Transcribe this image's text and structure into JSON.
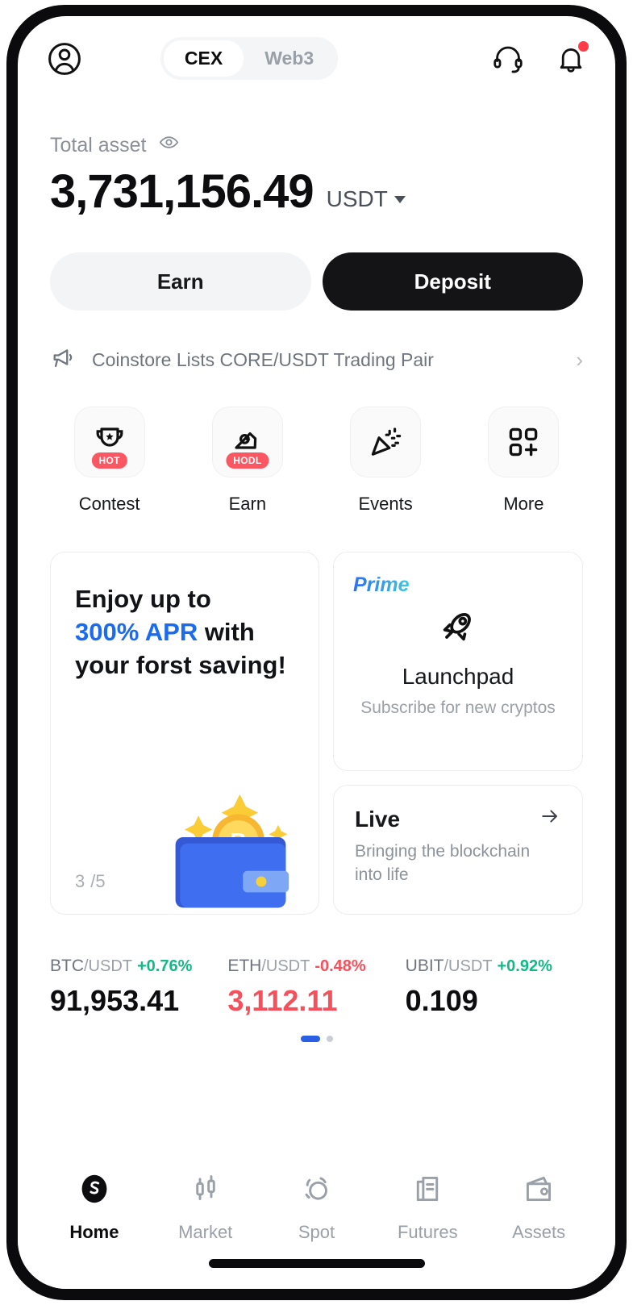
{
  "header": {
    "avatar_icon": "user-circle-icon",
    "segments": [
      {
        "label": "CEX",
        "active": true
      },
      {
        "label": "Web3",
        "active": false
      }
    ],
    "support_icon": "headset-icon",
    "notification_icon": "bell-icon",
    "has_notification": true
  },
  "balance": {
    "label": "Total asset",
    "eye_icon": "eye-icon",
    "amount": "3,731,156.49",
    "currency": "USDT"
  },
  "actions": {
    "earn_label": "Earn",
    "deposit_label": "Deposit"
  },
  "announcement": {
    "icon": "megaphone-icon",
    "text": "Coinstore Lists CORE/USDT Trading Pair",
    "chevron": "›"
  },
  "quick_actions": [
    {
      "label": "Contest",
      "icon": "trophy-icon",
      "badge": "HOT"
    },
    {
      "label": "Earn",
      "icon": "piggy-hand-icon",
      "badge": "HODL"
    },
    {
      "label": "Events",
      "icon": "party-popper-icon",
      "badge": ""
    },
    {
      "label": "More",
      "icon": "grid-plus-icon",
      "badge": ""
    }
  ],
  "promo_card": {
    "line1": "Enjoy up to",
    "highlight": "300% APR",
    "line2_rest": " with",
    "line3": "your forst saving!",
    "counter_current": "3",
    "counter_total": "/5",
    "art": "wallet-bitcoin-illustration",
    "highlight_color": "#1a6bf0"
  },
  "launchpad_card": {
    "badge": "Prime",
    "icon": "rocket-icon",
    "title": "Launchpad",
    "subtitle": "Subscribe for new cryptos"
  },
  "live_card": {
    "title": "Live",
    "arrow_icon": "arrow-right-icon",
    "subtitle": "Bringing the blockchain into life"
  },
  "tickers": [
    {
      "symbol": "BTC",
      "quote": "/USDT",
      "change": "+0.76%",
      "price": "91,953.41",
      "direction": "up"
    },
    {
      "symbol": "ETH",
      "quote": "/USDT",
      "change": "-0.48%",
      "price": "3,112.11",
      "direction": "down"
    },
    {
      "symbol": "UBIT",
      "quote": "/USDT",
      "change": "+0.92%",
      "price": "0.109",
      "direction": "up"
    }
  ],
  "carousel": {
    "active_index": 0,
    "count": 2
  },
  "nav": [
    {
      "label": "Home",
      "icon": "coinstore-logo-icon",
      "active": true
    },
    {
      "label": "Market",
      "icon": "candlestick-icon",
      "active": false
    },
    {
      "label": "Spot",
      "icon": "swap-circles-icon",
      "active": false
    },
    {
      "label": "Futures",
      "icon": "document-chart-icon",
      "active": false
    },
    {
      "label": "Assets",
      "icon": "wallet-icon",
      "active": false
    }
  ],
  "colors": {
    "up": "#12b886",
    "down": "#f5505c",
    "accent_blue": "#1a6bf0",
    "badge_red": "#fb5763"
  }
}
